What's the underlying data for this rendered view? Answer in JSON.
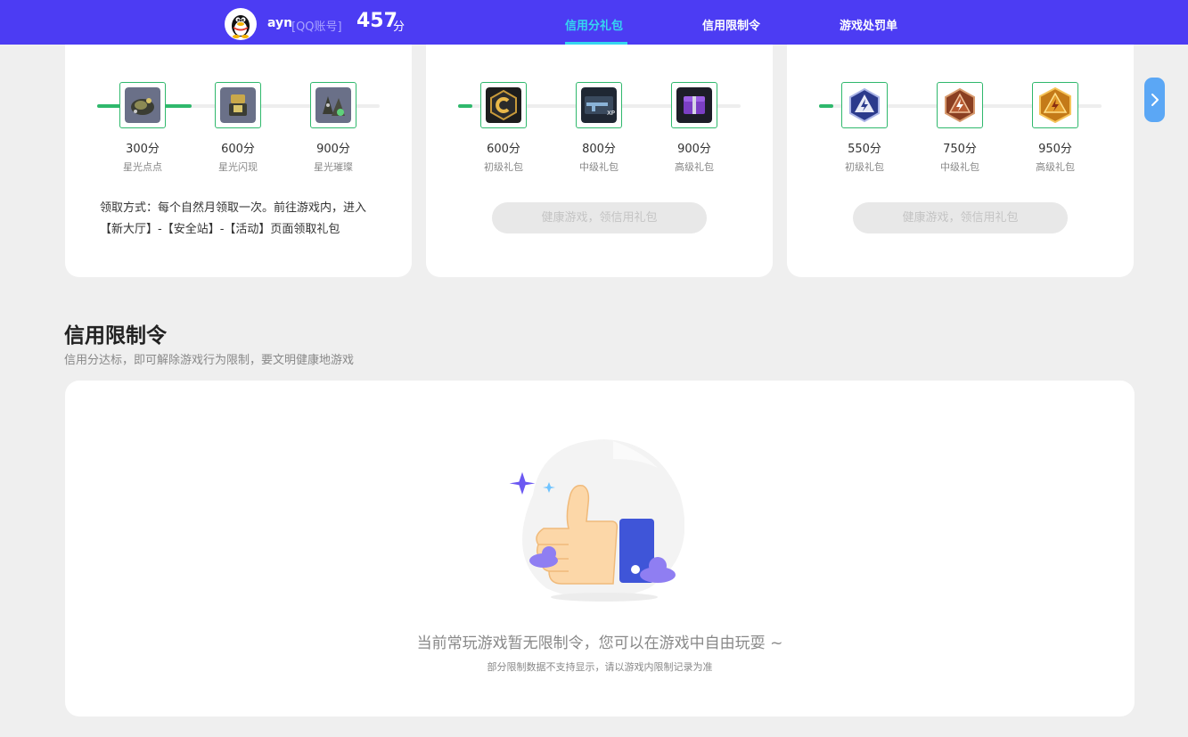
{
  "header": {
    "username": "ayn",
    "account_type": "[QQ账号]",
    "score": "457",
    "score_unit": "分",
    "tabs": [
      {
        "label": "信用分礼包",
        "active": true
      },
      {
        "label": "信用限制令",
        "active": false
      },
      {
        "label": "游戏处罚单",
        "active": false
      }
    ],
    "accent_color": "#4c3cf3",
    "active_tab_color": "#35d6f0"
  },
  "gift_cards": [
    {
      "progress": "~1.5 of 3 tiers reached",
      "rewards": [
        {
          "points": "300分",
          "name": "星光点点",
          "icon": "starlight-grenade-icon"
        },
        {
          "points": "600分",
          "name": "星光闪现",
          "icon": "starlight-flash-icon"
        },
        {
          "points": "900分",
          "name": "星光璀璨",
          "icon": "starlight-bright-icon"
        }
      ],
      "method_text": "领取方式：每个自然月领取一次。前往游戏内，进入【新大厅】-【安全站】-【活动】页面领取礼包"
    },
    {
      "progress": "below first tier",
      "rewards": [
        {
          "points": "600分",
          "name": "初级礼包",
          "icon": "coin-badge-icon"
        },
        {
          "points": "800分",
          "name": "中级礼包",
          "icon": "xp-rifle-icon"
        },
        {
          "points": "900分",
          "name": "高级礼包",
          "icon": "gift-chest-icon"
        }
      ],
      "button_label": "健康游戏，领信用礼包"
    },
    {
      "progress": "below first tier",
      "rewards": [
        {
          "points": "550分",
          "name": "初级礼包",
          "icon": "blue-rank-badge-icon"
        },
        {
          "points": "750分",
          "name": "中级礼包",
          "icon": "bronze-rank-badge-icon"
        },
        {
          "points": "950分",
          "name": "高级礼包",
          "icon": "gold-rank-badge-icon"
        }
      ],
      "button_label": "健康游戏，领信用礼包"
    }
  ],
  "restriction_section": {
    "title": "信用限制令",
    "subtitle": "信用分达标，即可解除游戏行为限制，要文明健康地游戏",
    "empty_message": "当前常玩游戏暂无限制令，您可以在游戏中自由玩耍 ~",
    "empty_note": "部分限制数据不支持显示，请以游戏内限制记录为准",
    "illustration_icon": "thumbs-up-icon"
  },
  "progress_color": "#2fb86c"
}
